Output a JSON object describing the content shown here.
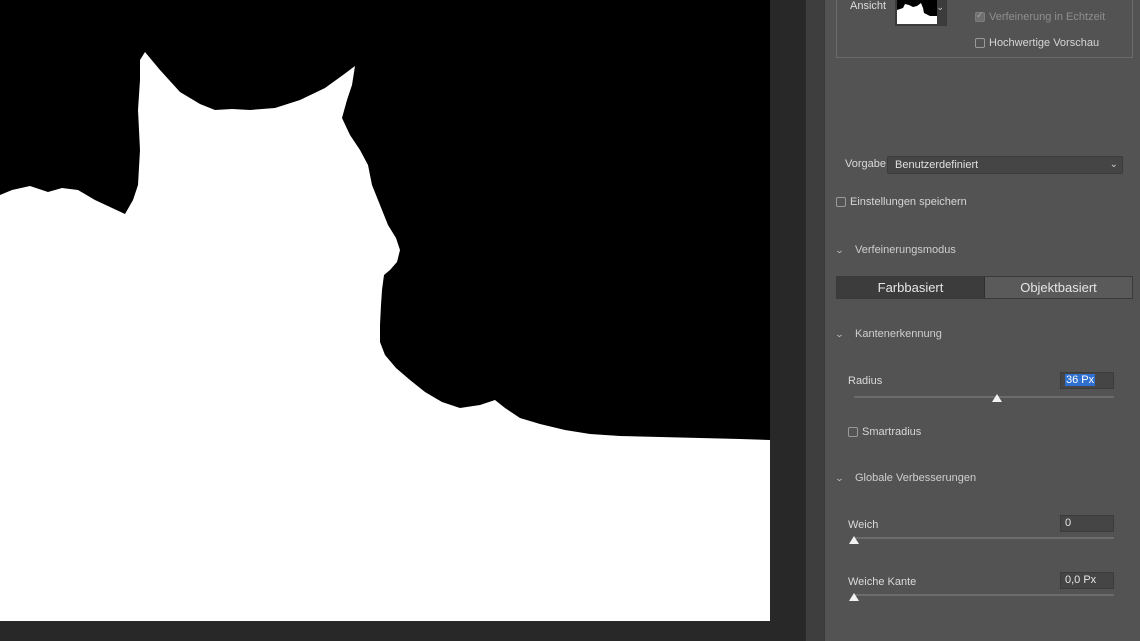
{
  "panel": {
    "view_label": "Ansicht",
    "realtime_refine_label": "Verfeinerung in Echtzeit",
    "realtime_refine_checked": true,
    "realtime_refine_disabled": true,
    "hq_preview_label": "Hochwertige Vorschau",
    "hq_preview_checked": false,
    "preset_label": "Vorgabe",
    "preset_value": "Benutzerdefiniert",
    "save_settings_label": "Einstellungen speichern",
    "save_settings_checked": false,
    "refine_mode": {
      "heading": "Verfeinerungsmodus",
      "options": [
        "Farbbasiert",
        "Objektbasiert"
      ],
      "active": "Farbbasiert"
    },
    "edge_detection": {
      "heading": "Kantenerkennung",
      "radius_label": "Radius",
      "radius_value": "36 Px",
      "radius_slider_fraction": 0.55,
      "smart_radius_label": "Smartradius",
      "smart_radius_checked": false
    },
    "global_refinements": {
      "heading": "Globale Verbesserungen",
      "smooth_label": "Weich",
      "smooth_value": "0",
      "smooth_slider_fraction": 0.0,
      "feather_label": "Weiche Kante",
      "feather_value": "0,0 Px",
      "feather_slider_fraction": 0.0
    }
  },
  "colors": {
    "panel_bg": "#535353",
    "canvas_bg": "#282828",
    "mask_black": "#000000",
    "mask_white": "#ffffff",
    "selection_highlight": "#2f6fce"
  },
  "icons": {
    "chevron_down": "chevron-down-icon",
    "collapse": "collapse-chevron-icon"
  }
}
